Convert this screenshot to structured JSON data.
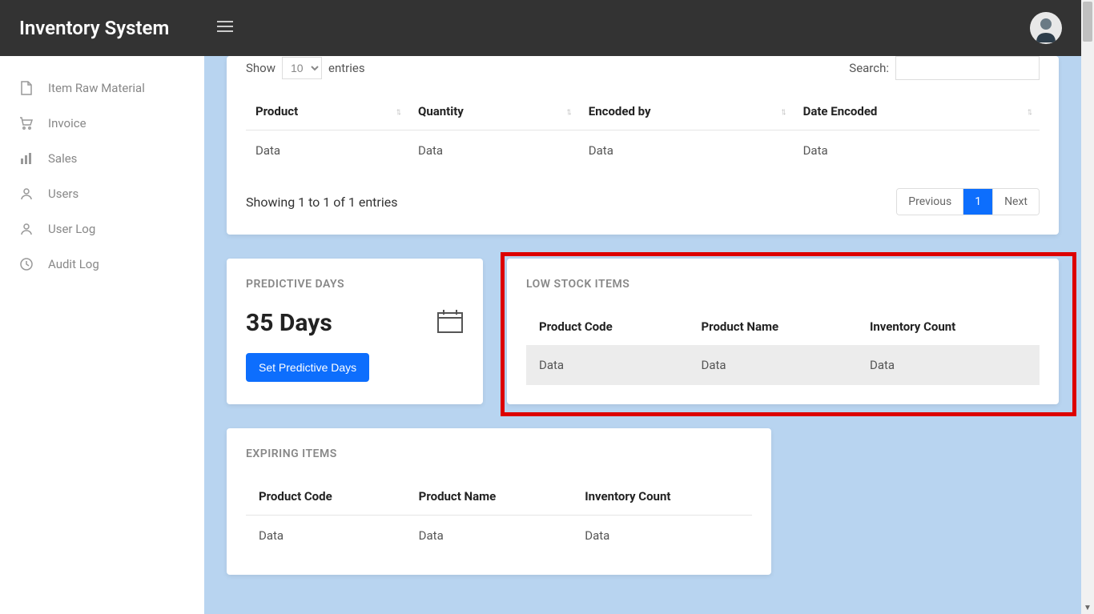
{
  "app": {
    "title": "Inventory System"
  },
  "sidebar": {
    "items": [
      {
        "label": "Item Raw Material",
        "icon": "file"
      },
      {
        "label": "Invoice",
        "icon": "cart"
      },
      {
        "label": "Sales",
        "icon": "bars"
      },
      {
        "label": "Users",
        "icon": "user"
      },
      {
        "label": "User Log",
        "icon": "user"
      },
      {
        "label": "Audit Log",
        "icon": "clock"
      }
    ]
  },
  "top_table": {
    "show_label_prefix": "Show",
    "show_value": "10",
    "show_label_suffix": "entries",
    "search_label": "Search:",
    "columns": [
      "Product",
      "Quantity",
      "Encoded by",
      "Date Encoded"
    ],
    "rows": [
      [
        "Data",
        "Data",
        "Data",
        "Data"
      ]
    ],
    "showing": "Showing 1 to 1 of 1 entries",
    "pagination": {
      "prev": "Previous",
      "current": "1",
      "next": "Next"
    }
  },
  "predictive": {
    "title": "PREDICTIVE DAYS",
    "value": "35 Days",
    "button": "Set Predictive Days"
  },
  "low_stock": {
    "title": "LOW STOCK ITEMS",
    "columns": [
      "Product Code",
      "Product Name",
      "Inventory Count"
    ],
    "rows": [
      [
        "Data",
        "Data",
        "Data"
      ]
    ]
  },
  "expiring": {
    "title": "EXPIRING ITEMS",
    "columns": [
      "Product Code",
      "Product Name",
      "Inventory Count"
    ],
    "rows": [
      [
        "Data",
        "Data",
        "Data"
      ]
    ]
  }
}
